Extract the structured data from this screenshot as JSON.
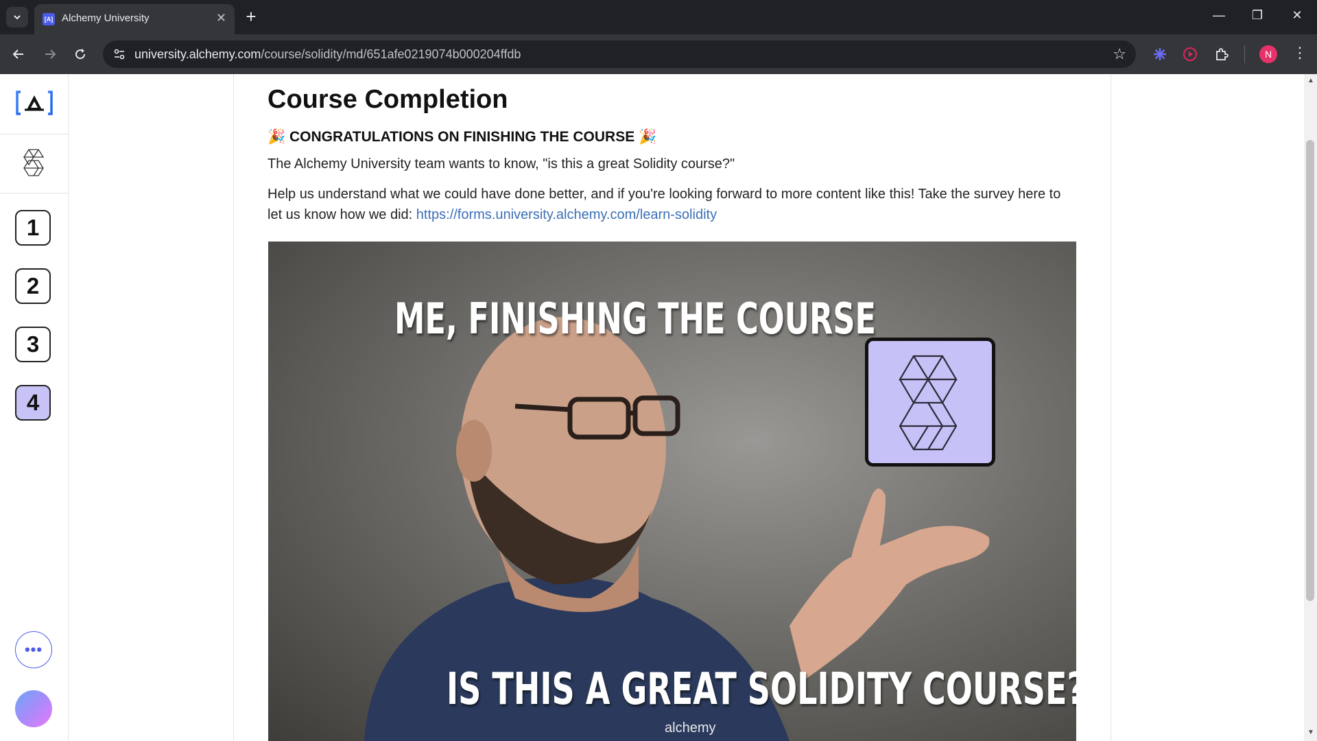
{
  "browser": {
    "tab": {
      "title": "Alchemy University",
      "favicon_text": "[A]"
    },
    "url_host": "university.alchemy.com",
    "url_path": "/course/solidity/md/651afe0219074b000204ffdb",
    "profile_initial": "N",
    "icons": {
      "tab_menu": "chevron-down-icon",
      "new_tab": "plus-icon",
      "minimize": "minimize-icon",
      "restore": "restore-icon",
      "close": "close-icon",
      "back": "back-arrow-icon",
      "forward": "forward-arrow-icon",
      "reload": "reload-icon",
      "site_info": "site-settings-icon",
      "bookmark": "star-icon",
      "extensions": "puzzle-icon",
      "menu": "kebab-menu-icon"
    }
  },
  "sidebar": {
    "steps": [
      "1",
      "2",
      "3",
      "4"
    ],
    "active_step": "4",
    "more_label": "•••"
  },
  "content": {
    "title": "Course Completion",
    "congrats": "🎉 CONGRATULATIONS ON FINISHING THE COURSE 🎉",
    "p1": "The Alchemy University team wants to know, \"is this a great Solidity course?\"",
    "p2_text": "Help us understand what we could have done better, and if you're looking forward to more content like this! Take the survey here to let us know how we did: ",
    "p2_link": "https://forms.university.alchemy.com/learn-solidity"
  },
  "hero_image": {
    "caption_top": "ME, FINISHING THE COURSE",
    "caption_bottom": "IS THIS A GREAT SOLIDITY COURSE?",
    "shirt_text": "alchemy"
  },
  "colors": {
    "accent": "#4a5be8",
    "active_step_bg": "#c7c3f7",
    "link": "#3b6fb6",
    "chrome_dark": "#202124",
    "chrome_toolbar": "#35363a"
  }
}
